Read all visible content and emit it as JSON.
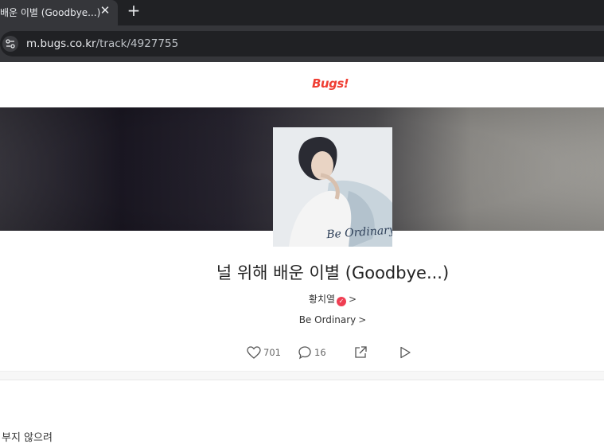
{
  "browser": {
    "tab_title": "배운 이별 (Goodbye...)",
    "tab_close": "✕",
    "new_tab": "+",
    "url_host": "m.bugs.co.kr",
    "url_path": "/track/4927755"
  },
  "header": {
    "logo_text": "Bugs!"
  },
  "track": {
    "title": "널 위해 배운 이별 (Goodbye...)",
    "artist": "황치열",
    "album": "Be Ordinary",
    "chevron": ">",
    "verified_mark": "✓",
    "cover_text": "Be Ordinary"
  },
  "actions": {
    "likes": "701",
    "comments": "16"
  },
  "lyrics": {
    "first_line": "부지 않으려"
  },
  "colors": {
    "brand": "#ef3e33",
    "verified": "#ef3e52"
  }
}
